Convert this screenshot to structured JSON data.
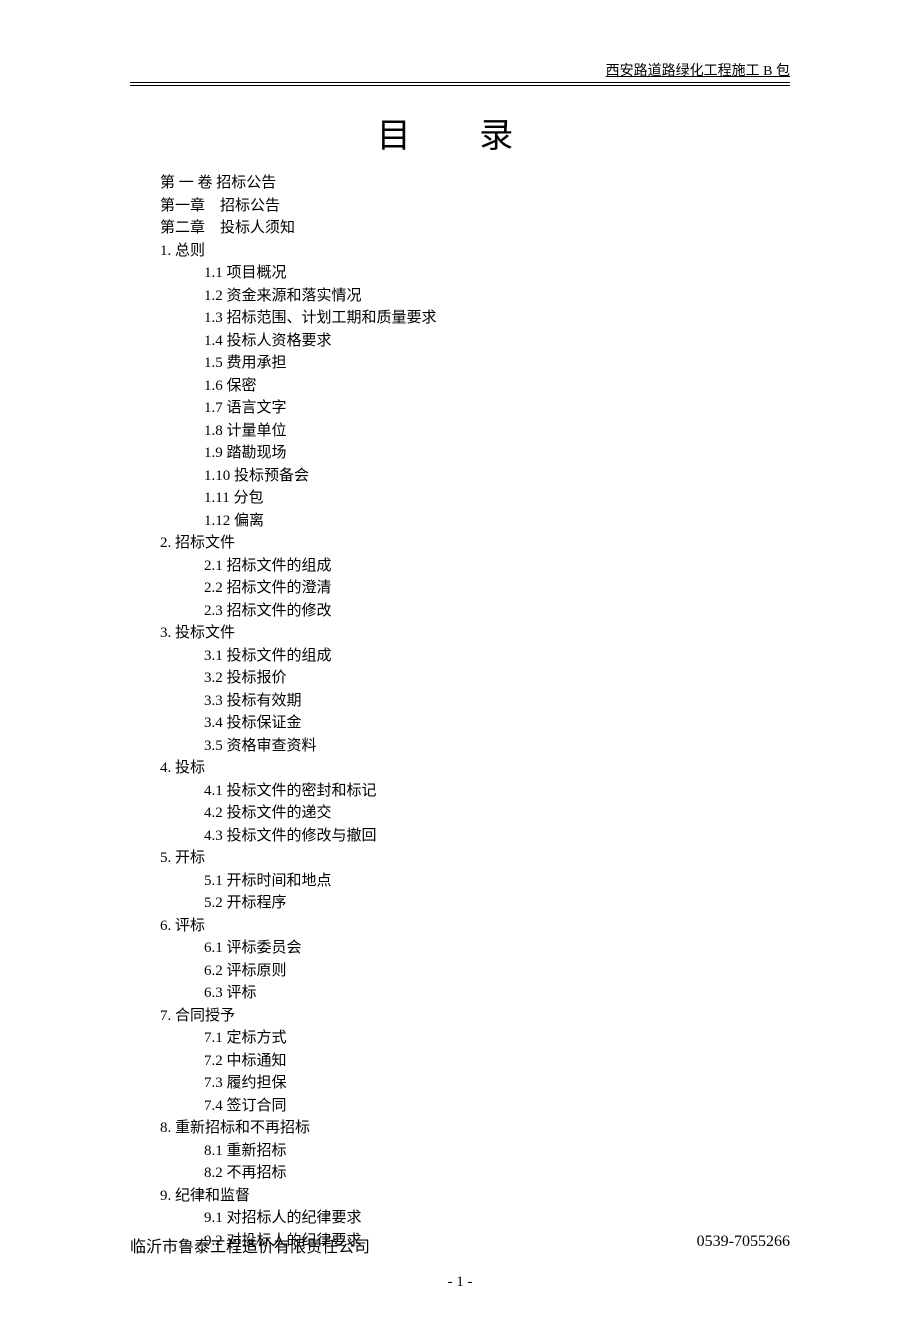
{
  "header": "西安路道路绿化工程施工 B 包",
  "title": "目 录",
  "toc": [
    {
      "level": 0,
      "text": "第 一 卷 招标公告"
    },
    {
      "level": 0,
      "text": "第一章　招标公告"
    },
    {
      "level": 0,
      "text": "第二章　投标人须知"
    },
    {
      "level": 1,
      "text": "1. 总则"
    },
    {
      "level": 2,
      "text": "1.1 项目概况"
    },
    {
      "level": 2,
      "text": "1.2 资金来源和落实情况"
    },
    {
      "level": 2,
      "text": "1.3 招标范围、计划工期和质量要求"
    },
    {
      "level": 2,
      "text": "1.4 投标人资格要求"
    },
    {
      "level": 2,
      "text": "1.5 费用承担"
    },
    {
      "level": 2,
      "text": "1.6 保密"
    },
    {
      "level": 2,
      "text": "1.7 语言文字"
    },
    {
      "level": 2,
      "text": "1.8 计量单位"
    },
    {
      "level": 2,
      "text": "1.9 踏勘现场"
    },
    {
      "level": 2,
      "text": "1.10 投标预备会"
    },
    {
      "level": 2,
      "text": "1.11 分包"
    },
    {
      "level": 2,
      "text": "1.12 偏离"
    },
    {
      "level": 1,
      "text": "2. 招标文件"
    },
    {
      "level": 2,
      "text": "2.1 招标文件的组成"
    },
    {
      "level": 2,
      "text": "2.2 招标文件的澄清"
    },
    {
      "level": 2,
      "text": "2.3 招标文件的修改"
    },
    {
      "level": 1,
      "text": "3. 投标文件"
    },
    {
      "level": 2,
      "text": "3.1 投标文件的组成"
    },
    {
      "level": 2,
      "text": "3.2 投标报价"
    },
    {
      "level": 2,
      "text": "3.3 投标有效期"
    },
    {
      "level": 2,
      "text": "3.4 投标保证金"
    },
    {
      "level": 2,
      "text": "3.5 资格审查资料"
    },
    {
      "level": 1,
      "text": "4. 投标"
    },
    {
      "level": 2,
      "text": "4.1 投标文件的密封和标记"
    },
    {
      "level": 2,
      "text": "4.2 投标文件的递交"
    },
    {
      "level": 2,
      "text": "4.3 投标文件的修改与撤回"
    },
    {
      "level": 1,
      "text": "5. 开标"
    },
    {
      "level": 2,
      "text": "5.1 开标时间和地点"
    },
    {
      "level": 2,
      "text": "5.2 开标程序"
    },
    {
      "level": 1,
      "text": "6. 评标"
    },
    {
      "level": 2,
      "text": "6.1 评标委员会"
    },
    {
      "level": 2,
      "text": "6.2 评标原则"
    },
    {
      "level": 2,
      "text": "6.3 评标"
    },
    {
      "level": 1,
      "text": "7. 合同授予"
    },
    {
      "level": 2,
      "text": "7.1 定标方式"
    },
    {
      "level": 2,
      "text": "7.2 中标通知"
    },
    {
      "level": 2,
      "text": "7.3 履约担保"
    },
    {
      "level": 2,
      "text": "7.4 签订合同"
    },
    {
      "level": 1,
      "text": "8. 重新招标和不再招标"
    },
    {
      "level": 2,
      "text": "8.1 重新招标"
    },
    {
      "level": 2,
      "text": "8.2 不再招标"
    },
    {
      "level": 1,
      "text": "9. 纪律和监督"
    },
    {
      "level": 2,
      "text": "9.1 对招标人的纪律要求"
    },
    {
      "level": 2,
      "text": "9.2 对投标人的纪律要求"
    }
  ],
  "page_number": "- 1 -",
  "footer": {
    "left": "临沂市鲁泰工程造价有限责任公司",
    "right": "0539-7055266"
  }
}
